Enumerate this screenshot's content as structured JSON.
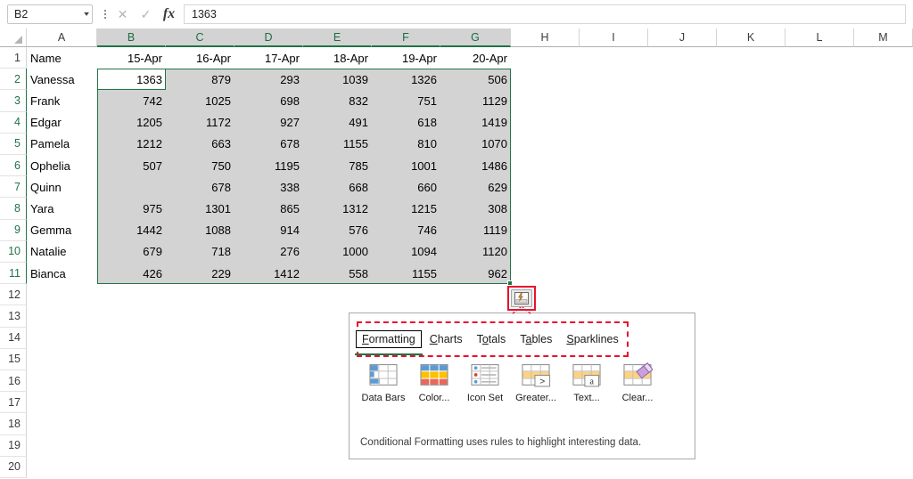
{
  "formula_bar": {
    "name_box_value": "B2",
    "name_box_icon": "chevron-down-icon",
    "kebab_icon": "more-options-icon",
    "cancel_icon": "✕",
    "enter_icon": "✓",
    "fx_icon": "fx",
    "formula_value": "1363"
  },
  "grid": {
    "corner_icon": "select-all-triangle-icon",
    "column_headers": [
      "A",
      "B",
      "C",
      "D",
      "E",
      "F",
      "G",
      "H",
      "I",
      "J",
      "K",
      "L",
      "M"
    ],
    "selected_columns": [
      "B",
      "C",
      "D",
      "E",
      "F",
      "G"
    ],
    "row_headers": [
      "1",
      "2",
      "3",
      "4",
      "5",
      "6",
      "7",
      "8",
      "9",
      "10",
      "11",
      "12",
      "13",
      "14",
      "15",
      "16",
      "17",
      "18",
      "19",
      "20"
    ],
    "selected_rows": [
      "2",
      "3",
      "4",
      "5",
      "6",
      "7",
      "8",
      "9",
      "10",
      "11"
    ],
    "header_row": [
      "Name",
      "15-Apr",
      "16-Apr",
      "17-Apr",
      "18-Apr",
      "19-Apr",
      "20-Apr"
    ],
    "rows": [
      {
        "name": "Vanessa",
        "values": [
          "1363",
          "879",
          "293",
          "1039",
          "1326",
          "506"
        ]
      },
      {
        "name": "Frank",
        "values": [
          "742",
          "1025",
          "698",
          "832",
          "751",
          "1129"
        ]
      },
      {
        "name": "Edgar",
        "values": [
          "1205",
          "1172",
          "927",
          "491",
          "618",
          "1419"
        ]
      },
      {
        "name": "Pamela",
        "values": [
          "1212",
          "663",
          "678",
          "1155",
          "810",
          "1070"
        ]
      },
      {
        "name": "Ophelia",
        "values": [
          "507",
          "750",
          "1195",
          "785",
          "1001",
          "1486"
        ]
      },
      {
        "name": "Quinn",
        "values": [
          "",
          "678",
          "338",
          "668",
          "660",
          "629"
        ]
      },
      {
        "name": "Yara",
        "values": [
          "975",
          "1301",
          "865",
          "1312",
          "1215",
          "308"
        ]
      },
      {
        "name": "Gemma",
        "values": [
          "1442",
          "1088",
          "914",
          "576",
          "746",
          "1119"
        ]
      },
      {
        "name": "Natalie",
        "values": [
          "679",
          "718",
          "276",
          "1000",
          "1094",
          "1120"
        ]
      },
      {
        "name": "Bianca",
        "values": [
          "426",
          "229",
          "1412",
          "558",
          "1155",
          "962"
        ]
      }
    ],
    "active_cell": "B2",
    "selection_range": "B2:G11"
  },
  "quick_analysis": {
    "button_icon": "quick-analysis-icon",
    "tabs": [
      {
        "label": "Formatting",
        "accel_before": "",
        "accel": "F",
        "accel_after": "ormatting",
        "active": true
      },
      {
        "label": "Charts",
        "accel_before": "",
        "accel": "C",
        "accel_after": "harts",
        "active": false
      },
      {
        "label": "Totals",
        "accel_before": "T",
        "accel": "o",
        "accel_after": "tals",
        "active": false
      },
      {
        "label": "Tables",
        "accel_before": "T",
        "accel": "a",
        "accel_after": "bles",
        "active": false
      },
      {
        "label": "Sparklines",
        "accel_before": "",
        "accel": "S",
        "accel_after": "parklines",
        "active": false
      }
    ],
    "items": [
      {
        "label": "Data Bars",
        "icon": "data-bars-icon"
      },
      {
        "label": "Color...",
        "icon": "color-scale-icon"
      },
      {
        "label": "Icon Set",
        "icon": "icon-set-icon"
      },
      {
        "label": "Greater...",
        "icon": "greater-than-icon"
      },
      {
        "label": "Text...",
        "icon": "text-contains-icon"
      },
      {
        "label": "Clear...",
        "icon": "clear-format-icon"
      }
    ],
    "footer": "Conditional Formatting uses rules to highlight interesting data.",
    "highlight_color": "#e8112d",
    "accent_color": "#217346"
  }
}
